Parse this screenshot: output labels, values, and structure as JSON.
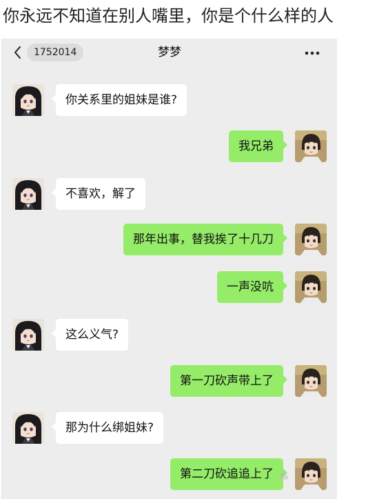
{
  "caption": "你永远不知道在别人嘴里，你是个什么样的人",
  "chat": {
    "back_badge": "1752014",
    "title": "梦梦",
    "messages": [
      {
        "side": "left",
        "text": "你关系里的姐妹是谁?"
      },
      {
        "side": "right",
        "text": "我兄弟"
      },
      {
        "side": "left",
        "text": "不喜欢，解了"
      },
      {
        "side": "right",
        "text": "那年出事，替我挨了十几刀"
      },
      {
        "side": "right",
        "text": "一声没吭"
      },
      {
        "side": "left",
        "text": "这么义气?"
      },
      {
        "side": "right",
        "text": "第一刀砍声带上了"
      },
      {
        "side": "left",
        "text": "那为什么绑姐妹?"
      },
      {
        "side": "right",
        "text": "第二刀砍追追上了"
      }
    ]
  },
  "icons": {
    "back": "chevron-left-icon",
    "more": "more-dots-icon",
    "watermark": "wechat-watermark-icon"
  },
  "colors": {
    "chat_background": "#ededed",
    "bubble_self": "#95ec69",
    "bubble_other": "#ffffff"
  }
}
